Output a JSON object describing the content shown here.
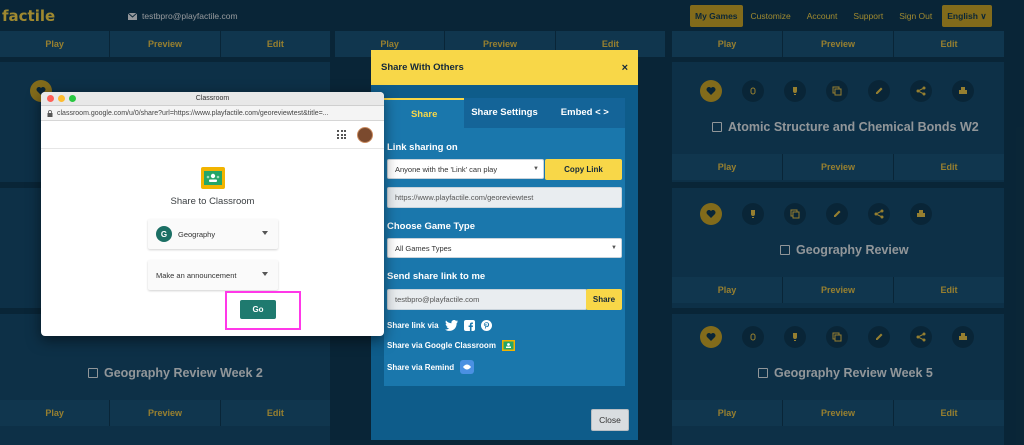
{
  "nav": {
    "logo": "factile",
    "email": "testbpro@playfactile.com",
    "items": [
      "My Games",
      "Customize",
      "Account",
      "Support",
      "Sign Out"
    ],
    "language": "English ∨"
  },
  "board": {
    "actions": {
      "play": "Play",
      "preview": "Preview",
      "edit": "Edit"
    },
    "games": [
      {
        "title": "Atomic Structure and Chemical Bonds W2"
      },
      {
        "title": "Geography Review"
      },
      {
        "title": "Geography Review Week 2"
      },
      {
        "title": "Geography Review Week 5"
      }
    ]
  },
  "share_modal": {
    "title": "Share With Others",
    "close_x": "×",
    "tabs": [
      "Share",
      "Share Settings",
      "Embed < >"
    ],
    "link_sharing": {
      "heading": "Link sharing on",
      "option": "Anyone with the 'Link' can play",
      "copy_button": "Copy Link",
      "url": "https://www.playfactile.com/georeviewtest"
    },
    "game_type": {
      "heading": "Choose Game Type",
      "option": "All Games Types"
    },
    "send_link": {
      "heading": "Send share link to me",
      "email": "testbpro@playfactile.com",
      "button": "Share"
    },
    "share_via_label": "Share link via",
    "google_classroom": "Share via Google Classroom",
    "remind": "Share via Remind",
    "close_button": "Close"
  },
  "classroom_popup": {
    "window_title": "Classroom",
    "url": "classroom.google.com/u/0/share?url=https://www.playfactile.com/georeviewtest&title=...",
    "heading": "Share to Classroom",
    "class_initial": "G",
    "class_name": "Geography",
    "action": "Make an announcement",
    "go_button": "Go"
  },
  "colors": {
    "board_bg": "#0f3a55",
    "card_bg": "#154a6d",
    "accent_yellow": "#f8d748",
    "modal_blue": "#0e5c8a",
    "classroom_green": "#1f7a6f",
    "highlight_pink": "#ff38e8"
  }
}
